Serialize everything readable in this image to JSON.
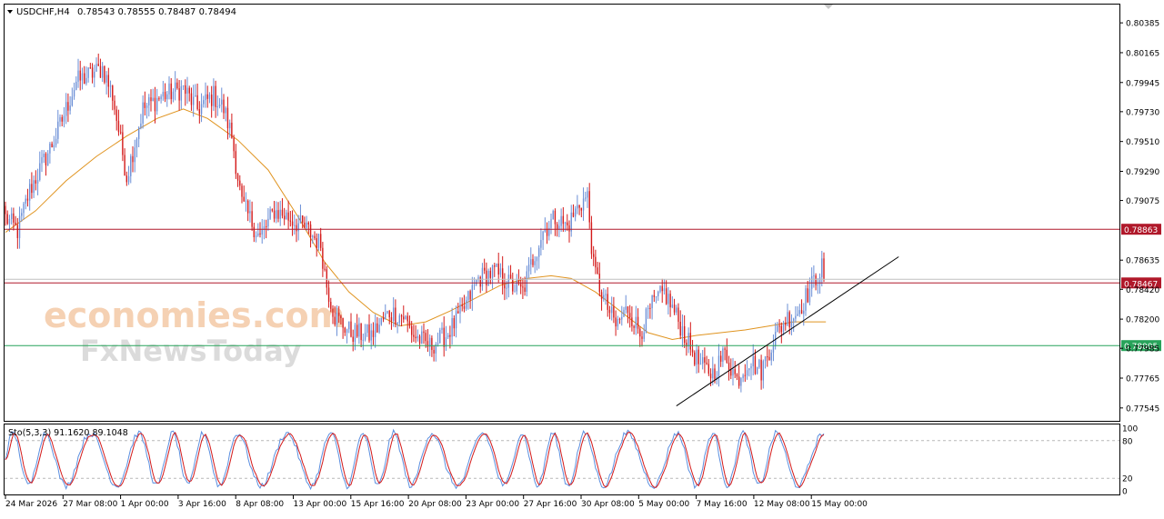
{
  "header": {
    "symbol": "USDCHF,H4",
    "ohlc": "0.78543 0.78555 0.78487 0.78494"
  },
  "watermark": {
    "line1": "economies.com",
    "line2": "FxNewsToday"
  },
  "colors": {
    "bull": "#6b8fd6",
    "bear": "#d41a1a",
    "ma": "#e09420",
    "resistance": "#b0182a",
    "support": "#27a35a",
    "price_line": "#b0182a",
    "stoch_main": "#5b8fe0",
    "stoch_signal": "#d41a1a",
    "trendline": "#000000"
  },
  "chart_data": [
    {
      "type": "candlestick",
      "title": "",
      "ylim": [
        0.7745,
        0.8052
      ],
      "y_ticks": [
        "0.80385",
        "0.80165",
        "0.79945",
        "0.79730",
        "0.79510",
        "0.79290",
        "0.79075",
        "0.78635",
        "0.78420",
        "0.78200",
        "0.77985",
        "0.77765",
        "0.77545"
      ],
      "x_ticks": [
        "24 Mar 2026",
        "27 Mar 08:00",
        "1 Apr 00:00",
        "3 Apr 16:00",
        "8 Apr 08:00",
        "13 Apr 00:00",
        "15 Apr 16:00",
        "20 Apr 08:00",
        "23 Apr 00:00",
        "27 Apr 16:00",
        "30 Apr 08:00",
        "5 May 00:00",
        "7 May 16:00",
        "12 May 08:00",
        "15 May 00:00"
      ],
      "n_bars": 300,
      "anchors": [
        [
          0,
          0.7895
        ],
        [
          6,
          0.7885
        ],
        [
          12,
          0.7915
        ],
        [
          25,
          0.7955
        ],
        [
          35,
          0.7995
        ],
        [
          48,
          0.8005
        ],
        [
          53,
          0.7985
        ],
        [
          60,
          0.7925
        ],
        [
          68,
          0.7975
        ],
        [
          78,
          0.7985
        ],
        [
          88,
          0.799
        ],
        [
          95,
          0.7975
        ],
        [
          103,
          0.7985
        ],
        [
          108,
          0.7975
        ],
        [
          112,
          0.7955
        ],
        [
          117,
          0.7905
        ],
        [
          126,
          0.788
        ],
        [
          133,
          0.79
        ],
        [
          140,
          0.7895
        ],
        [
          150,
          0.7885
        ],
        [
          156,
          0.7875
        ],
        [
          159,
          0.7845
        ],
        [
          163,
          0.7822
        ],
        [
          171,
          0.781
        ],
        [
          181,
          0.7808
        ],
        [
          190,
          0.7825
        ],
        [
          197,
          0.7822
        ],
        [
          202,
          0.7808
        ],
        [
          210,
          0.78
        ],
        [
          218,
          0.7808
        ],
        [
          226,
          0.7825
        ],
        [
          234,
          0.785
        ],
        [
          242,
          0.7855
        ],
        [
          250,
          0.7845
        ],
        [
          256,
          0.784
        ],
        [
          260,
          0.786
        ],
        [
          266,
          0.7885
        ],
        [
          272,
          0.7895
        ],
        [
          278,
          0.7888
        ],
        [
          284,
          0.7905
        ],
        [
          288,
          0.791
        ],
        [
          291,
          0.7858
        ]
      ],
      "anchors_tail": [
        [
          291,
          0.7858
        ],
        [
          296,
          0.7835
        ],
        [
          302,
          0.7815
        ],
        [
          308,
          0.7828
        ],
        [
          314,
          0.781
        ],
        [
          320,
          0.783
        ],
        [
          326,
          0.784
        ],
        [
          332,
          0.7822
        ],
        [
          338,
          0.7802
        ],
        [
          344,
          0.7785
        ],
        [
          350,
          0.778
        ],
        [
          356,
          0.7795
        ],
        [
          362,
          0.7775
        ],
        [
          368,
          0.779
        ],
        [
          374,
          0.7782
        ],
        [
          380,
          0.7805
        ],
        [
          386,
          0.782
        ],
        [
          392,
          0.7825
        ],
        [
          398,
          0.7842
        ],
        [
          404,
          0.7858
        ],
        [
          406,
          0.785
        ]
      ],
      "moving_average": [
        [
          0,
          0.7884
        ],
        [
          15,
          0.79
        ],
        [
          30,
          0.7922
        ],
        [
          45,
          0.794
        ],
        [
          60,
          0.7955
        ],
        [
          75,
          0.7968
        ],
        [
          88,
          0.7975
        ],
        [
          100,
          0.7968
        ],
        [
          115,
          0.7952
        ],
        [
          130,
          0.793
        ],
        [
          145,
          0.7895
        ],
        [
          158,
          0.7862
        ],
        [
          170,
          0.784
        ],
        [
          182,
          0.7825
        ],
        [
          195,
          0.7815
        ],
        [
          208,
          0.7818
        ],
        [
          220,
          0.7826
        ],
        [
          232,
          0.7835
        ],
        [
          245,
          0.7845
        ],
        [
          258,
          0.785
        ],
        [
          270,
          0.7852
        ],
        [
          280,
          0.785
        ],
        [
          292,
          0.784
        ],
        [
          305,
          0.7825
        ],
        [
          318,
          0.781
        ],
        [
          330,
          0.7805
        ],
        [
          342,
          0.7808
        ],
        [
          354,
          0.781
        ],
        [
          366,
          0.7812
        ],
        [
          378,
          0.7815
        ],
        [
          390,
          0.7818
        ],
        [
          406,
          0.7818
        ]
      ],
      "horizontal_lines": [
        {
          "price": 0.78863,
          "label": "0.78863",
          "role": "resistance"
        },
        {
          "price": 0.78467,
          "label": "0.78467",
          "role": "price"
        },
        {
          "price": 0.78005,
          "label": "0.78005",
          "role": "support"
        }
      ],
      "trendline": [
        [
          0.7756,
          0.7866
        ]
      ]
    },
    {
      "type": "line",
      "title": "Sto(5,3,3) 91.1620 89.1048",
      "ylim": [
        0,
        100
      ],
      "y_ticks": [
        "100",
        "80",
        "20",
        "0"
      ],
      "levels": [
        80,
        20
      ],
      "series": [
        {
          "name": "Sto main",
          "last": 91.162
        },
        {
          "name": "Sto signal",
          "last": 89.1048
        }
      ]
    }
  ]
}
